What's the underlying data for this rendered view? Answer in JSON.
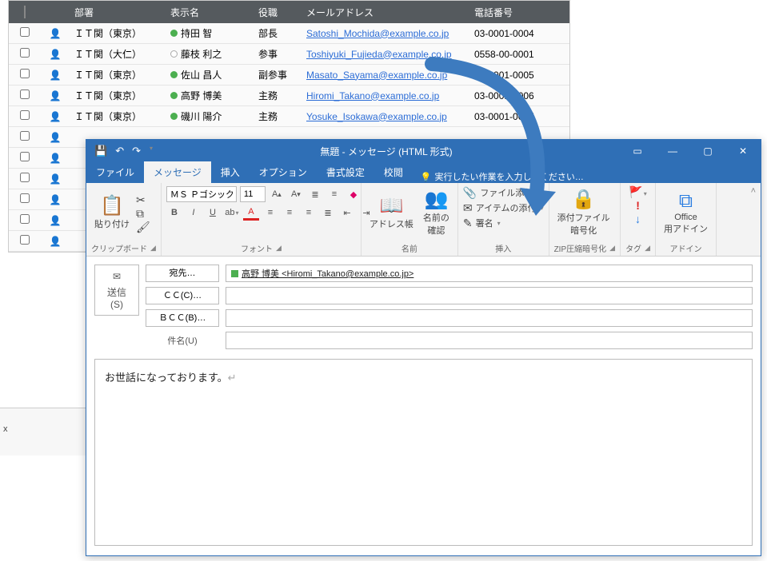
{
  "table": {
    "headers": {
      "dept": "部署",
      "name": "表示名",
      "role": "役職",
      "mail": "メールアドレス",
      "phone": "電話番号"
    },
    "rows": [
      {
        "dept": "ＩＴ関（東京）",
        "presence": "green",
        "name": "持田 智",
        "role": "部長",
        "mail": "Satoshi_Mochida@example.co.jp",
        "phone": "03-0001-0004"
      },
      {
        "dept": "ＩＴ関（大仁）",
        "presence": "white",
        "name": "藤枝 利之",
        "role": "参事",
        "mail": "Toshiyuki_Fujieda@example.co.jp",
        "phone": "0558-00-0001"
      },
      {
        "dept": "ＩＴ関（東京）",
        "presence": "green",
        "name": "佐山 昌人",
        "role": "副参事",
        "mail": "Masato_Sayama@example.co.jp",
        "phone": "03-0001-0005"
      },
      {
        "dept": "ＩＴ関（東京）",
        "presence": "green",
        "name": "高野 博美",
        "role": "主務",
        "mail": "Hiromi_Takano@example.co.jp",
        "phone": "03-0001-0006"
      },
      {
        "dept": "ＩＴ関（東京）",
        "presence": "green",
        "name": "磯川 陽介",
        "role": "主務",
        "mail": "Yosuke_Isokawa@example.co.jp",
        "phone": "03-0001-0007"
      },
      {
        "dept": "",
        "presence": "",
        "name": "",
        "role": "",
        "mail": "",
        "phone": ""
      },
      {
        "dept": "",
        "presence": "",
        "name": "",
        "role": "",
        "mail": "",
        "phone": ""
      },
      {
        "dept": "",
        "presence": "",
        "name": "",
        "role": "",
        "mail": "",
        "phone": ""
      },
      {
        "dept": "",
        "presence": "",
        "name": "",
        "role": "",
        "mail": "",
        "phone": ""
      },
      {
        "dept": "",
        "presence": "",
        "name": "",
        "role": "",
        "mail": "",
        "phone": ""
      },
      {
        "dept": "",
        "presence": "",
        "name": "",
        "role": "",
        "mail": "",
        "phone": ""
      }
    ]
  },
  "outlook": {
    "title": "無題 - メッセージ (HTML 形式)",
    "tabs": {
      "file": "ファイル",
      "message": "メッセージ",
      "insert": "挿入",
      "options": "オプション",
      "format": "書式設定",
      "review": "校閲"
    },
    "tellme": "実行したい作業を入力してください…",
    "ribbon": {
      "clipboard": {
        "paste": "貼り付け",
        "label": "クリップボード"
      },
      "font": {
        "name": "ＭＳ Ｐゴシック",
        "size": "11",
        "label": "フォント"
      },
      "names": {
        "addrbook": "アドレス帳",
        "checknames": "名前の\n確認",
        "label": "名前"
      },
      "include": {
        "attachfile": "ファイル添付 ",
        "attachitem": "アイテムの添付 ",
        "signature": "署名 ",
        "label": "挿入"
      },
      "zip": {
        "big": "添付ファイル\n暗号化",
        "label": "ZIP圧縮暗号化"
      },
      "tags": {
        "label": "タグ"
      },
      "addins": {
        "big": "Office\n用アドイン",
        "label": "アドイン"
      }
    },
    "compose": {
      "send": "送信\n(S)",
      "to_btn": "宛先…",
      "cc_btn": "ＣＣ(C)…",
      "bcc_btn": "ＢＣＣ(B)…",
      "subject_label": "件名(U)",
      "recipient": "高野 博美 <Hiromi_Takano@example.co.jp>",
      "body": "お世話になっております。"
    }
  },
  "bottom_marker": "x"
}
